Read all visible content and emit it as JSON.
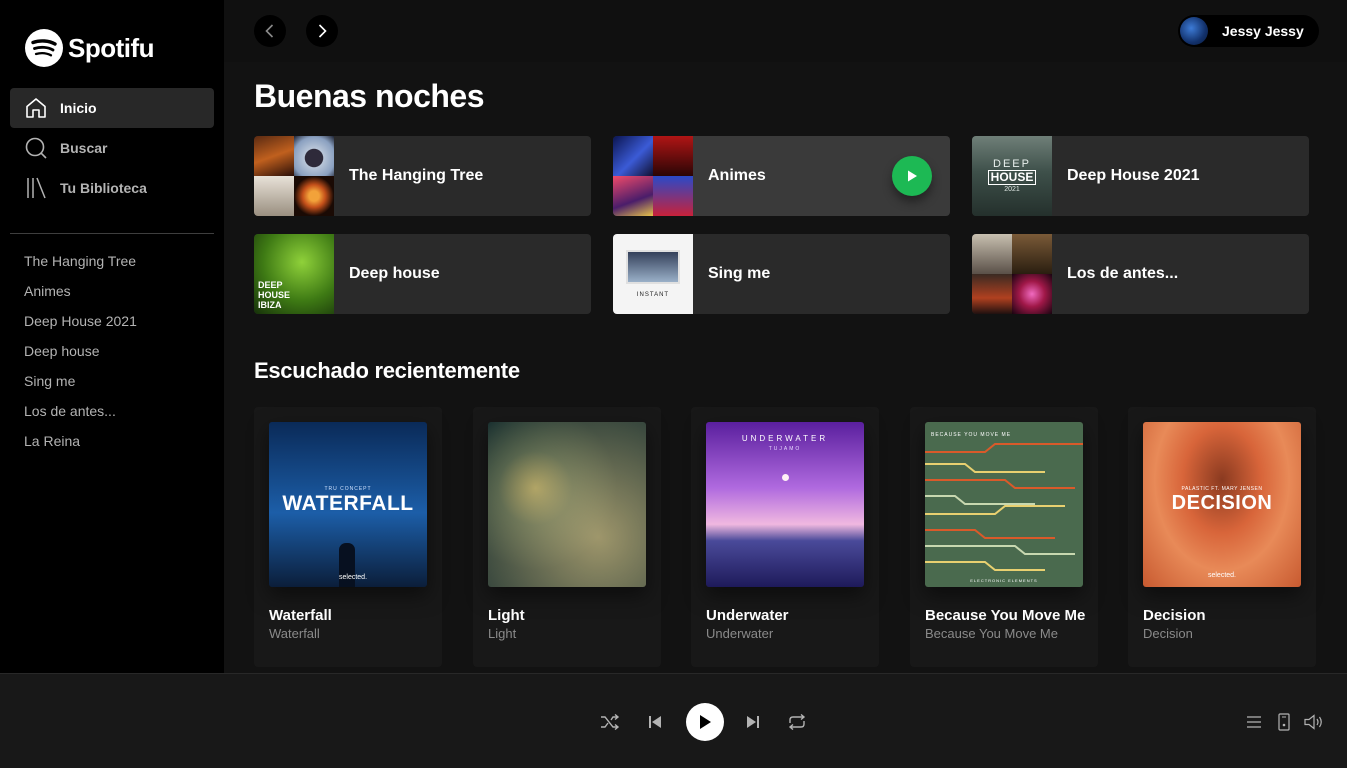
{
  "app": {
    "logo_text": "Spotifu"
  },
  "sidebar": {
    "nav": [
      {
        "label": "Inicio",
        "icon": "home-icon"
      },
      {
        "label": "Buscar",
        "icon": "search-icon"
      },
      {
        "label": "Tu Biblioteca",
        "icon": "library-icon"
      }
    ],
    "playlists": [
      "The Hanging Tree",
      "Animes",
      "Deep House 2021",
      "Deep house",
      "Sing me",
      "Los de antes...",
      "La Reina"
    ]
  },
  "topbar": {
    "back_icon": "chevron-left-icon",
    "forward_icon": "chevron-right-icon",
    "user_name": "Jessy Jessy"
  },
  "main": {
    "greeting": "Buenas noches",
    "quick_picks": [
      {
        "title": "The Hanging Tree"
      },
      {
        "title": "Animes"
      },
      {
        "title": "Deep House 2021"
      },
      {
        "title": "Deep house"
      },
      {
        "title": "Sing me"
      },
      {
        "title": "Los de antes..."
      }
    ],
    "recent_heading": "Escuchado recientemente",
    "recent": [
      {
        "title": "Waterfall",
        "subtitle": "Waterfall",
        "cover_text": "WATERFALL",
        "cover_small": "TRU CONCEPT"
      },
      {
        "title": "Light",
        "subtitle": "Light"
      },
      {
        "title": "Underwater",
        "subtitle": "Underwater",
        "cover_text": "UNDERWATER",
        "cover_small": "TUJAMO"
      },
      {
        "title": "Because You Move Me",
        "subtitle": "Because You Move Me",
        "cover_small": "BECAUSE YOU MOVE ME",
        "cover_bottom": "ELECTRONIC ELEMENTS"
      },
      {
        "title": "Decision",
        "subtitle": "Decision",
        "cover_text": "DECISION",
        "cover_small": "PALASTIC FT. MARY JENSEN"
      }
    ],
    "cover_texts": {
      "deep_house_2021_top": "DEEP",
      "deep_house_2021_mid": "HOUSE",
      "deep_house_2021_year": "2021",
      "deep_house_ibiza": "DEEP HOUSE IBIZA",
      "sing_me_label": "INSTANT",
      "selected_label": "selected."
    }
  },
  "player": {
    "controls": [
      "shuffle-icon",
      "previous-icon",
      "play-icon",
      "next-icon",
      "repeat-icon"
    ],
    "right_icons": [
      "queue-icon",
      "device-icon",
      "volume-icon"
    ]
  },
  "colors": {
    "accent": "#1db954",
    "background": "#121212",
    "sidebar": "#000000",
    "card": "#2a2a2a",
    "player": "#181818"
  }
}
